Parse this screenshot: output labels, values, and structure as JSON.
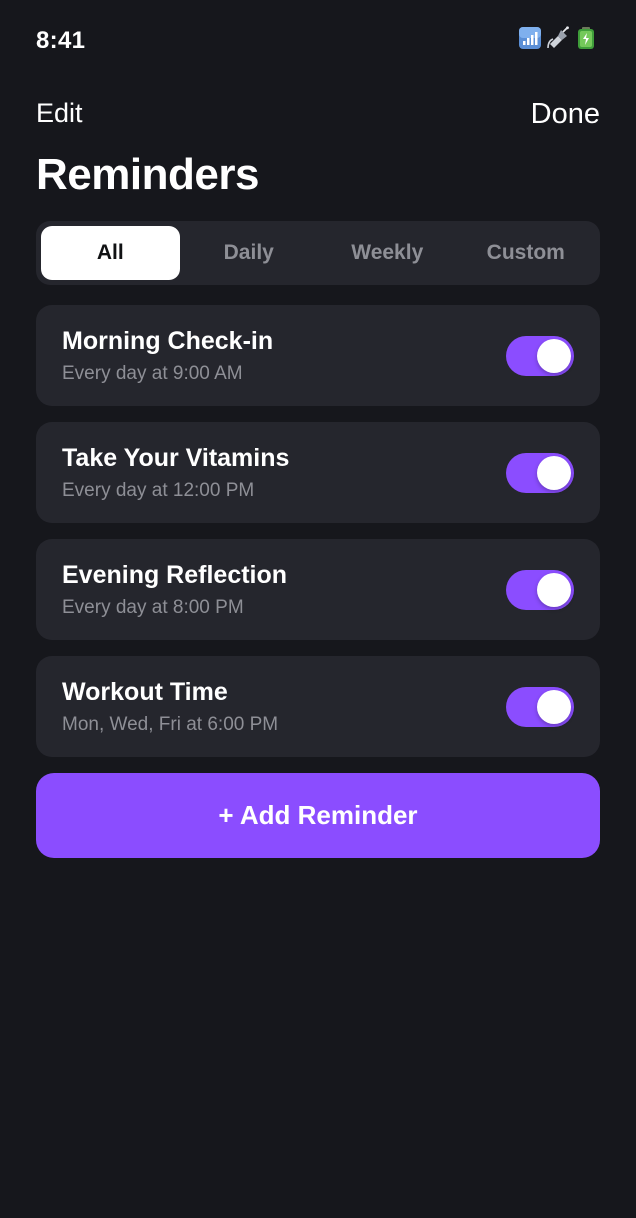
{
  "status_bar": {
    "time": "8:41",
    "icons": [
      "signal-icon",
      "satellite-icon",
      "battery-icon"
    ]
  },
  "nav": {
    "edit_label": "Edit",
    "done_label": "Done"
  },
  "page_title": "Reminders",
  "segments": [
    {
      "label": "All",
      "active": true
    },
    {
      "label": "Daily",
      "active": false
    },
    {
      "label": "Weekly",
      "active": false
    },
    {
      "label": "Custom",
      "active": false
    }
  ],
  "reminders": [
    {
      "title": "Morning Check-in",
      "schedule": "Every day at 9:00 AM",
      "enabled": true
    },
    {
      "title": "Take Your Vitamins",
      "schedule": "Every day at 12:00 PM",
      "enabled": true
    },
    {
      "title": "Evening Reflection",
      "schedule": "Every day at 8:00 PM",
      "enabled": true
    },
    {
      "title": "Workout Time",
      "schedule": "Mon, Wed, Fri at 6:00 PM",
      "enabled": true
    }
  ],
  "add_button_label": "+ Add Reminder",
  "colors": {
    "background": "#16171c",
    "card": "#25262d",
    "accent": "#8b4dff",
    "muted_text": "#8e8f96"
  }
}
